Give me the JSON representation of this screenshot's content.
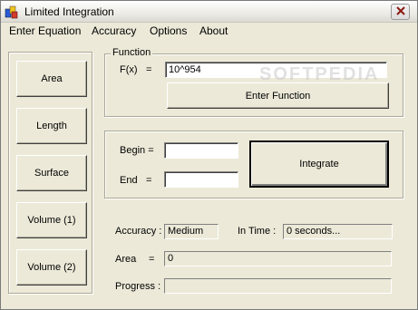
{
  "window": {
    "title": "Limited Integration"
  },
  "menu": [
    "Enter Equation",
    "Accuracy",
    "Options",
    "About"
  ],
  "sidebar": {
    "buttons": [
      "Area",
      "Length",
      "Surface",
      "Volume (1)",
      "Volume (2)"
    ]
  },
  "function_group": {
    "label": "Function",
    "fx_label": "F(x)",
    "eq": "=",
    "fx_value": "10^954",
    "enter_button": "Enter Function"
  },
  "bounds": {
    "begin_label": "Begin =",
    "end_label": "End",
    "end_eq": "=",
    "begin_value": "",
    "end_value": "",
    "integrate_button": "Integrate"
  },
  "results": {
    "accuracy_label": "Accuracy :",
    "accuracy_value": "Medium",
    "time_label": "In Time :",
    "time_value": "0  seconds...",
    "area_label": "Area",
    "area_eq": "=",
    "area_value": "0",
    "progress_label": "Progress :",
    "progress_fraction": 0
  },
  "watermark": "SOFTPEDIA",
  "icons": {
    "app": "app-icon",
    "close": "close-icon"
  }
}
